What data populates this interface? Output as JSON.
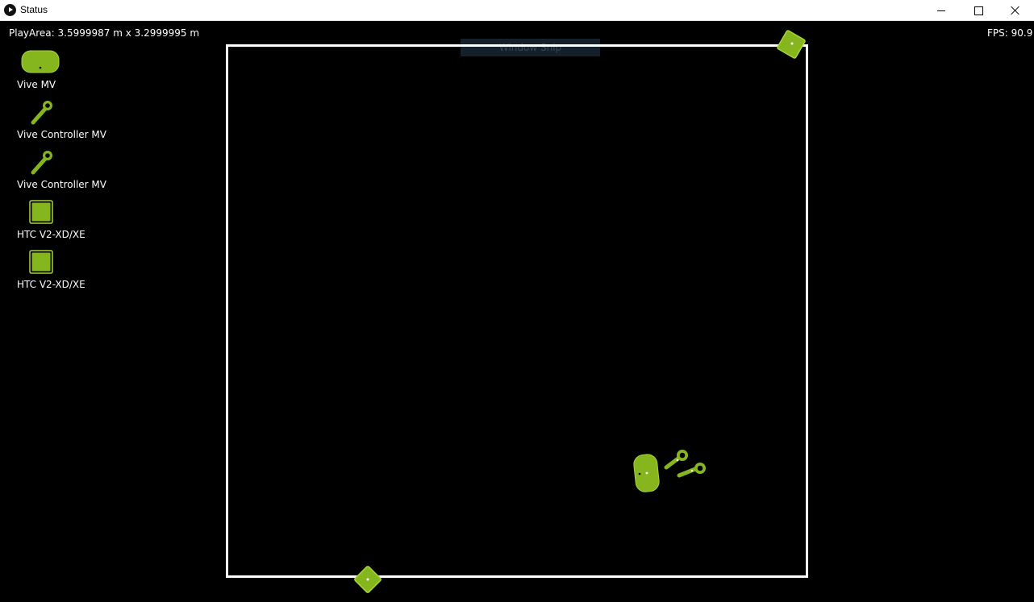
{
  "window": {
    "title": "Status",
    "controls": [
      "minimize",
      "maximize",
      "close"
    ]
  },
  "hud": {
    "play_area": "PlayArea: 3.5999987 m x 3.2999995 m",
    "fps": "FPS: 90.9"
  },
  "overlay": {
    "window_snip_label": "Window Snip"
  },
  "devices": [
    {
      "label": "Vive MV",
      "icon": "hmd-icon"
    },
    {
      "label": "Vive Controller MV",
      "icon": "controller-icon"
    },
    {
      "label": "Vive Controller MV",
      "icon": "controller-icon"
    },
    {
      "label": "HTC V2-XD/XE",
      "icon": "base-station-icon"
    },
    {
      "label": "HTC V2-XD/XE",
      "icon": "base-station-icon"
    }
  ],
  "colors": {
    "device_green": "#86b61e",
    "device_green_light": "#a7d43a",
    "background": "#000000",
    "play_area_border": "#ffffff"
  }
}
